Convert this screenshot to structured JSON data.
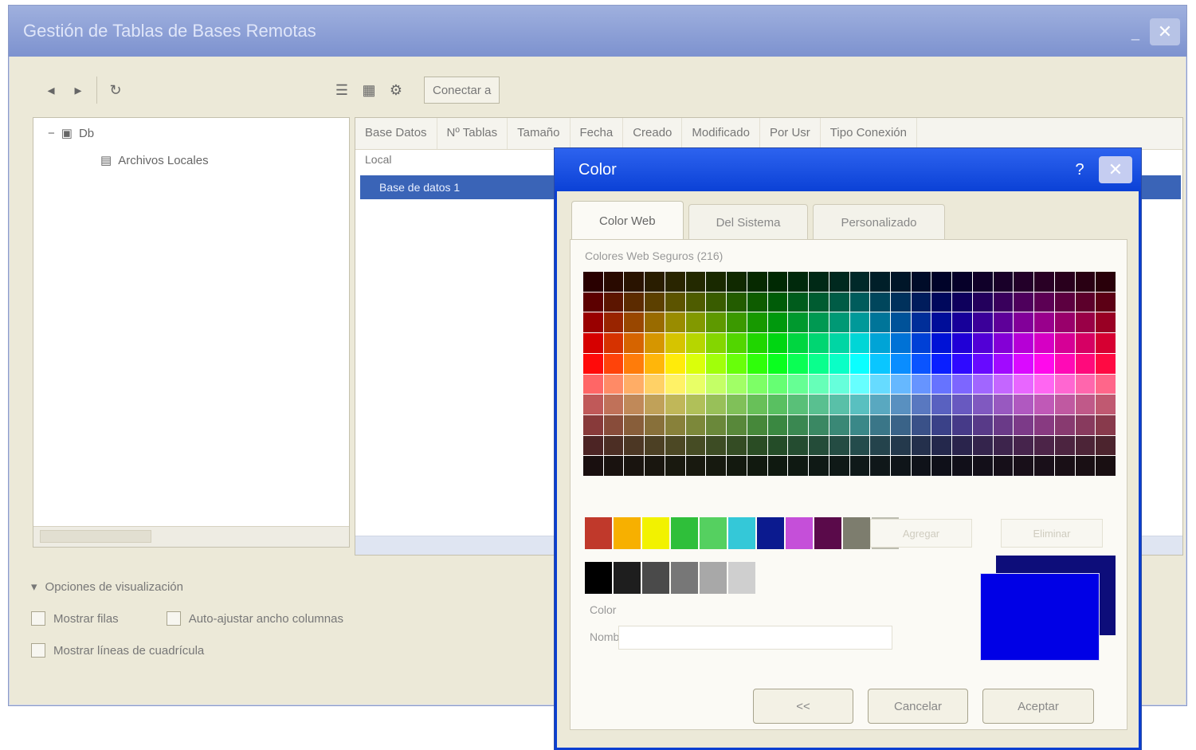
{
  "main_window": {
    "title": "Gestión de Tablas de Bases Remotas",
    "close_glyph": "✕",
    "minimize_glyph": "_",
    "toolbar": {
      "icons": [
        "back-icon",
        "forward-icon",
        "refresh-icon",
        "list-view-icon",
        "details-view-icon",
        "properties-icon"
      ],
      "dropdown_label": "Conectar a"
    },
    "tree": {
      "root_label": "Db",
      "child_label": "Archivos Locales"
    },
    "list": {
      "columns": [
        "Base Datos",
        "Nº Tablas",
        "Tamaño",
        "Fecha",
        "Creado",
        "Modificado",
        "Por Usr",
        "Tipo Conexión"
      ],
      "rows": [
        "Local",
        "Base de datos 1"
      ]
    },
    "options": {
      "header": "Opciones de visualización",
      "check1": "Mostrar filas",
      "check2": "Auto-ajustar ancho columnas",
      "check3": "Mostrar líneas de cuadrícula"
    }
  },
  "color_dialog": {
    "title": "Color",
    "help_glyph": "?",
    "close_glyph": "✕",
    "tabs": [
      "Color Web",
      "Del Sistema",
      "Personalizado"
    ],
    "active_tab": 0,
    "palette_label": "Colores Web Seguros (216)",
    "basic_colors": [
      "#c0392b",
      "#f7b000",
      "#f2f200",
      "#2fbf3a",
      "#55d060",
      "#34c8d8",
      "#0b1a8f",
      "#c54fd9",
      "#5a0a4a",
      "#7d7d6e",
      "#bdbdb0"
    ],
    "gray_colors": [
      "#000000",
      "#1e1e1e",
      "#4a4a4a",
      "#777777",
      "#a8a8a8",
      "#cfcfcf"
    ],
    "add_custom_label": "Agregar",
    "remove_custom_label": "Eliminar",
    "color_label": "Color",
    "name_label": "Nombre",
    "selected_color": "#0000e6",
    "previous_color": "#0d0d7a",
    "buttons": {
      "btn1": "<<",
      "btn2": "Cancelar",
      "btn3": "Aceptar"
    }
  }
}
